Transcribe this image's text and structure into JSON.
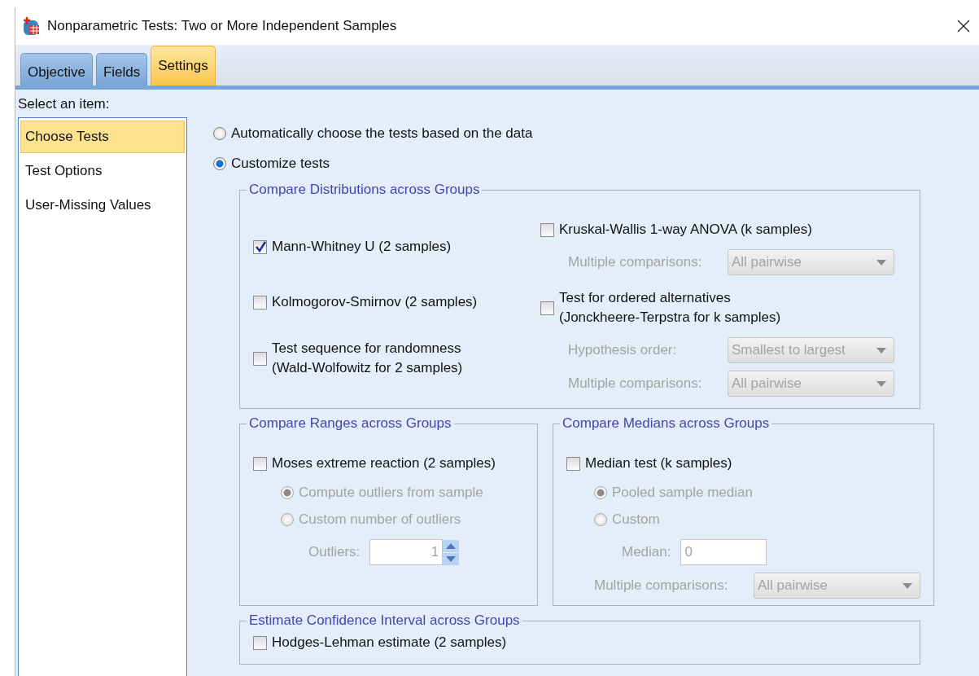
{
  "window": {
    "title": "Nonparametric Tests: Two or More Independent Samples"
  },
  "tabs": [
    {
      "label": "Objective",
      "selected": false
    },
    {
      "label": "Fields",
      "selected": false
    },
    {
      "label": "Settings",
      "selected": true
    }
  ],
  "sidebar": {
    "label": "Select an item:",
    "items": [
      {
        "label": "Choose Tests",
        "selected": true
      },
      {
        "label": "Test Options",
        "selected": false
      },
      {
        "label": "User-Missing Values",
        "selected": false
      }
    ]
  },
  "mode_options": [
    {
      "label": "Automatically choose the tests based on the data",
      "selected": false
    },
    {
      "label": "Customize tests",
      "selected": true
    }
  ],
  "group_rows": [
    [
      {
        "title": "Compare Distributions across Groups",
        "columns": [
          [
            {
              "kind": "checkbox",
              "label": "Mann-Whitney U (2 samples)",
              "checked": true
            },
            {
              "kind": "checkbox",
              "label": "Kolmogorov-Smirnov (2 samples)",
              "checked": false
            },
            {
              "kind": "checkbox",
              "label": "Test sequence for randomness\n(Wald-Wolfowitz for 2 samples)",
              "checked": false
            }
          ],
          [
            {
              "kind": "checkbox",
              "label": "Kruskal-Wallis 1-way ANOVA (k samples)",
              "checked": false,
              "children": [
                {
                  "kind": "dropdown",
                  "label": "Multiple comparisons:",
                  "value": "All pairwise",
                  "disabled": true
                }
              ]
            },
            {
              "kind": "checkbox",
              "label": "Test for ordered alternatives\n(Jonckheere-Terpstra for k samples)",
              "checked": false,
              "children": [
                {
                  "kind": "dropdown",
                  "label": "Hypothesis order:",
                  "value": "Smallest to largest",
                  "disabled": true
                },
                {
                  "kind": "dropdown",
                  "label": "Multiple comparisons:",
                  "value": "All pairwise",
                  "disabled": true
                }
              ]
            }
          ]
        ]
      }
    ],
    [
      {
        "title": "Compare Ranges across Groups",
        "columns": [
          [
            {
              "kind": "checkbox",
              "label": "Moses extreme reaction (2 samples)",
              "checked": false,
              "children": [
                {
                  "kind": "radio",
                  "label": "Compute outliers from sample",
                  "selected": true,
                  "disabled": true
                },
                {
                  "kind": "radio",
                  "label": "Custom number of outliers",
                  "selected": false,
                  "disabled": true,
                  "children": [
                    {
                      "kind": "spinner",
                      "label": "Outliers:",
                      "value": "1",
                      "disabled": true
                    }
                  ]
                }
              ]
            }
          ]
        ]
      },
      {
        "title": "Compare Medians across Groups",
        "columns": [
          [
            {
              "kind": "checkbox",
              "label": "Median test (k samples)",
              "checked": false,
              "children": [
                {
                  "kind": "radio",
                  "label": "Pooled sample median",
                  "selected": true,
                  "disabled": true
                },
                {
                  "kind": "radio",
                  "label": "Custom",
                  "selected": false,
                  "disabled": true,
                  "children": [
                    {
                      "kind": "textfield",
                      "label": "Median:",
                      "value": "0",
                      "disabled": true
                    }
                  ]
                },
                {
                  "kind": "dropdown",
                  "label": "Multiple comparisons:",
                  "value": "All pairwise",
                  "disabled": true
                }
              ]
            }
          ]
        ]
      }
    ],
    [
      {
        "title": "Estimate Confidence Interval across Groups",
        "columns": [
          [
            {
              "kind": "checkbox",
              "label": "Hodges-Lehman estimate (2 samples)",
              "checked": false
            }
          ]
        ]
      }
    ]
  ]
}
